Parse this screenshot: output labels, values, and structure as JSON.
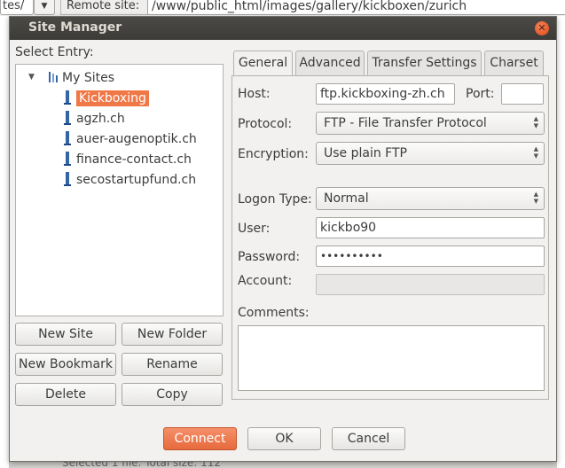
{
  "background": {
    "field1": "tes/",
    "field2": "▼",
    "remote_label": "Remote site:",
    "remote_path": "/www/public_html/images/gallery/kickboxen/zurich",
    "status_text": "Selected 1 file. Total size: 112"
  },
  "dialog": {
    "title": "Site Manager",
    "close_icon": "close-icon",
    "select_entry_label": "Select Entry:",
    "tree": {
      "root": "My Sites",
      "sites": [
        "Kickboxing",
        "agzh.ch",
        "auer-augenoptik.ch",
        "finance-contact.ch",
        "secostartupfund.ch"
      ],
      "selected_index": 0
    },
    "buttons": {
      "new_site": "New Site",
      "new_folder": "New Folder",
      "new_bookmark": "New Bookmark",
      "rename": "Rename",
      "delete": "Delete",
      "copy": "Copy"
    },
    "tabs": [
      "General",
      "Advanced",
      "Transfer Settings",
      "Charset"
    ],
    "active_tab": "General",
    "general": {
      "host_label": "Host:",
      "host_value": "ftp.kickboxing-zh.ch",
      "port_label": "Port:",
      "port_value": "",
      "protocol_label": "Protocol:",
      "protocol_value": "FTP - File Transfer Protocol",
      "encryption_label": "Encryption:",
      "encryption_value": "Use plain FTP",
      "logon_type_label": "Logon Type:",
      "logon_type_value": "Normal",
      "user_label": "User:",
      "user_value": "kickbo90",
      "password_label": "Password:",
      "password_value": "••••••••••",
      "account_label": "Account:",
      "account_value": "",
      "comments_label": "Comments:",
      "comments_value": ""
    },
    "footer": {
      "connect": "Connect",
      "ok": "OK",
      "cancel": "Cancel"
    }
  },
  "colors": {
    "accent": "#f07746",
    "titlebar": "#3c3b37",
    "dialog_bg": "#f2f1f0"
  }
}
